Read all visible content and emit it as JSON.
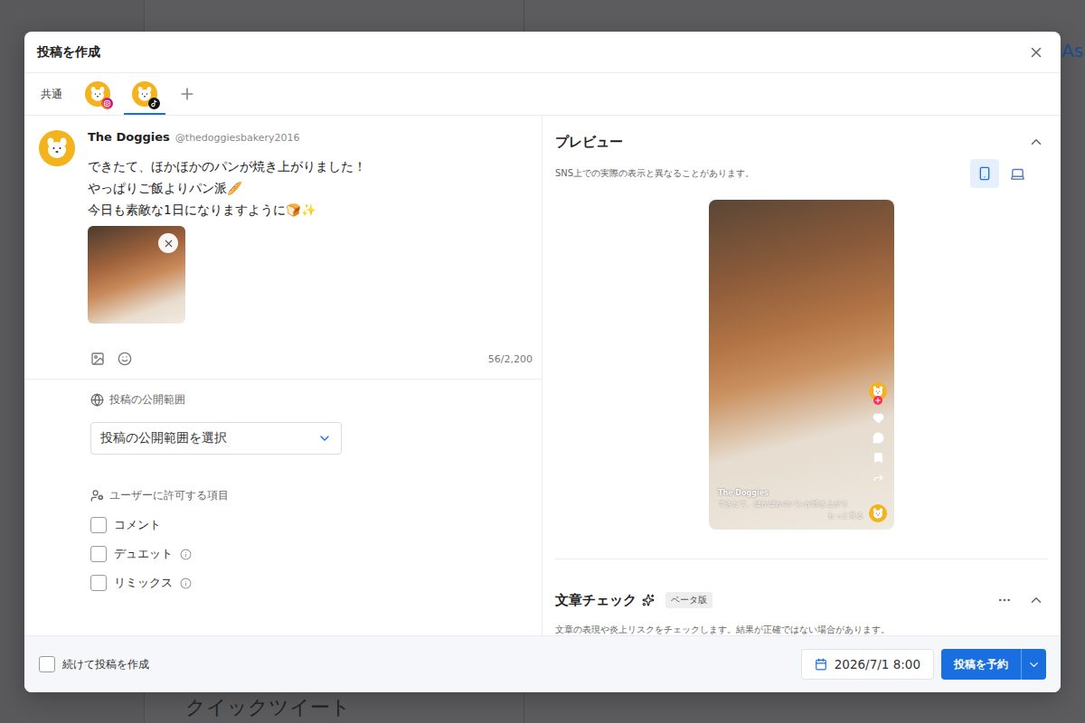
{
  "background": {
    "header_text": "As",
    "section_title": "クイックツイート"
  },
  "dialog": {
    "title": "投稿を作成"
  },
  "account_tabs": {
    "common_label": "共通",
    "tabs": [
      {
        "kind": "instagram",
        "selected": false
      },
      {
        "kind": "tiktok",
        "selected": true
      }
    ]
  },
  "post": {
    "name": "The Doggies",
    "handle": "@thedoggiesbakery2016",
    "lines": [
      "できたて、ほかほかのパンが焼き上がりました！",
      "やっぱりご飯よりパン派🥖",
      "今日も素敵な1日になりますように🍞✨"
    ],
    "char_count": "56/2,200"
  },
  "visibility": {
    "label": "投稿の公開範囲",
    "placeholder": "投稿の公開範囲を選択"
  },
  "permissions": {
    "label": "ユーザーに許可する項目",
    "items": [
      {
        "label": "コメント",
        "checked": false,
        "info": false
      },
      {
        "label": "デュエット",
        "checked": false,
        "info": true
      },
      {
        "label": "リミックス",
        "checked": false,
        "info": true
      }
    ]
  },
  "preview": {
    "title": "プレビュー",
    "note": "SNS上での実際の表示と異なることがあります。",
    "devices": [
      {
        "kind": "mobile",
        "selected": true
      },
      {
        "kind": "desktop",
        "selected": false
      }
    ],
    "phone": {
      "name": "The Doggies",
      "caption": "できたて、ほかほかのパンが焼き上がり",
      "more": "もっと見る"
    }
  },
  "text_check": {
    "title": "文章チェック",
    "badge": "ベータ版",
    "note": "文章の表現や炎上リスクをチェックします。結果が正確ではない場合があります。"
  },
  "footer": {
    "continue_label": "続けて投稿を作成",
    "continue_checked": false,
    "date": "2026/7/1 8:00",
    "submit": "投稿を予約"
  }
}
